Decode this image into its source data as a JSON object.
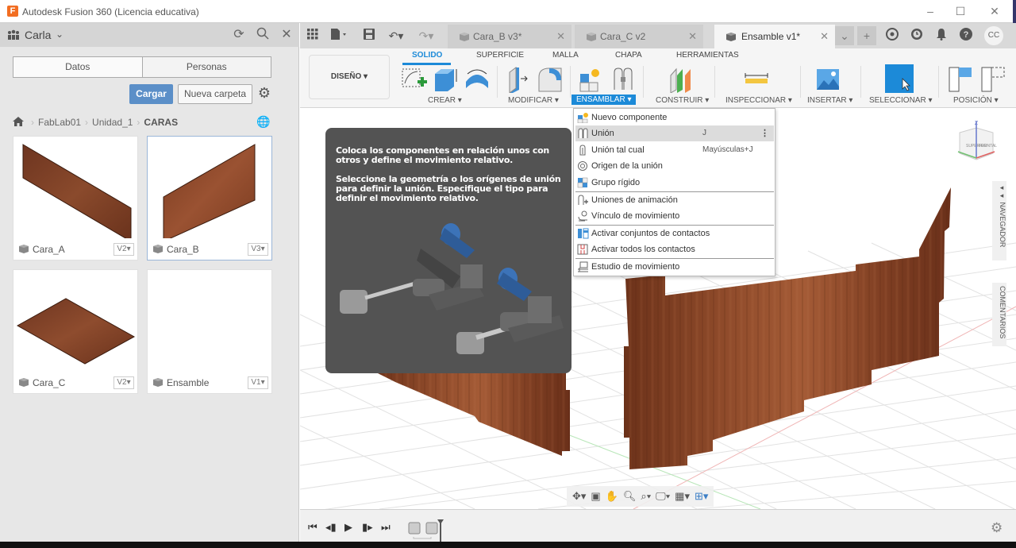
{
  "window": {
    "title": "Autodesk Fusion 360 (Licencia educativa)",
    "app_icon_letter": "F",
    "minimize": "–",
    "maximize": "☐",
    "close": "✕"
  },
  "data_panel": {
    "team": "Carla",
    "tabs": [
      "Datos",
      "Personas"
    ],
    "upload_label": "Cargar",
    "new_folder_label": "Nueva carpeta",
    "breadcrumb": [
      "FabLab01",
      "Unidad_1",
      "CARAS"
    ],
    "files": [
      {
        "name": "Cara_A",
        "version": "V2▾"
      },
      {
        "name": "Cara_B",
        "version": "V3▾"
      },
      {
        "name": "Cara_C",
        "version": "V2▾"
      },
      {
        "name": "Ensamble",
        "version": "V1▾"
      }
    ]
  },
  "tabs": [
    {
      "label": "Cara_B v3*"
    },
    {
      "label": "Cara_C v2"
    },
    {
      "label": "Ensamble v1*",
      "active": true
    }
  ],
  "user_initials": "CC",
  "toolbar": {
    "workspace": "DISEÑO ▾",
    "ribbon_tabs": [
      "SOLIDO",
      "SUPERFICIE",
      "MALLA",
      "CHAPA",
      "HERRAMIENTAS"
    ],
    "groups": [
      "CREAR ▾",
      "MODIFICAR ▾",
      "ENSAMBLAR ▾",
      "CONSTRUIR ▾",
      "INSPECCIONAR ▾",
      "INSERTAR ▾",
      "SELECCIONAR ▾",
      "POSICIÓN ▾"
    ]
  },
  "ensamblar_menu": [
    {
      "label": "Nuevo componente",
      "shortcut": ""
    },
    {
      "label": "Unión",
      "shortcut": "J",
      "highlighted": true
    },
    {
      "label": "Unión tal cual",
      "shortcut": "Mayúsculas+J"
    },
    {
      "label": "Origen de la unión",
      "shortcut": ""
    },
    {
      "label": "Grupo rígido",
      "shortcut": ""
    },
    {
      "label": "Uniones de animación",
      "shortcut": ""
    },
    {
      "label": "Vínculo de movimiento",
      "shortcut": ""
    },
    {
      "label": "Activar conjuntos de contactos",
      "shortcut": ""
    },
    {
      "label": "Activar todos los contactos",
      "shortcut": ""
    },
    {
      "label": "Estudio de movimiento",
      "shortcut": ""
    }
  ],
  "tooltip": {
    "p1": "Coloca los componentes en relación unos con otros y define el movimiento relativo.",
    "p2": "Seleccione la geometría o los orígenes de unión para definir la unión. Especifique el tipo para definir el movimiento relativo."
  },
  "side_panels": [
    "NAVEGADOR",
    "COMENTARIOS"
  ],
  "viewcube": {
    "top": "Z",
    "left_face": "SUPERIOR",
    "right_face": "FRONTAL"
  },
  "colors": {
    "accent": "#1c8ad8",
    "upload": "#5b8fc8",
    "wood": "#8a4526",
    "tooltip_bg": "#535353"
  }
}
